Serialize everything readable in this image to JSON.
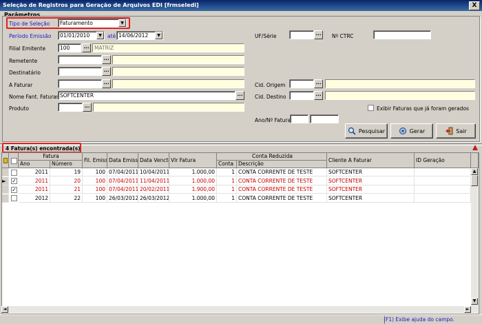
{
  "window": {
    "title": "Seleção de Registros para Geração de Arquivos EDI [frmseledi]",
    "close": "X"
  },
  "params": {
    "title": "Parâmetros",
    "tipo_label": "Tipo de Seleção",
    "tipo_value": "Faturamento",
    "periodo_label": "Período Emissão",
    "periodo_from": "01/01/2010",
    "ate_label": "até",
    "periodo_to": "14/06/2012",
    "filial_label": "Filial Emitente",
    "filial_code": "100",
    "filial_name": "MATRIZ",
    "remetente_label": "Remetente",
    "destinatario_label": "Destinatário",
    "afaturar_label": "A Faturar",
    "nomefant_label": "Nome Fant. Faturar",
    "nomefant_value": "SOFTCENTER",
    "produto_label": "Produto",
    "uf_label": "UF/Série",
    "nctrc_label": "Nº CTRC",
    "cidorigem_label": "Cid. Origem",
    "ciddestino_label": "Cid. Destino",
    "exibir_label": "Exibir Faturas que já foram gerados",
    "anofatura_label": "Ano/Nº Fatura",
    "dots": "..."
  },
  "buttons": {
    "pesquisar": "Pesquisar",
    "gerar": "Gerar",
    "sair": "Sair"
  },
  "grid": {
    "found": "4 Fatura(s) encontrada(s)",
    "group_fatura": "Fatura",
    "group_conta": "Conta Reduzida",
    "headers": {
      "ano": "Ano",
      "numero": "Número",
      "filemis": "Fil. Emiss.",
      "dataemis": "Data Emiss.",
      "datavencto": "Data Vencto",
      "vlrfatura": "Vlr Fatura",
      "conta": "Conta",
      "descricao": "Descrição",
      "cliente": "Cliente A Faturar",
      "idgeracao": "ID Geração"
    },
    "rows": [
      {
        "checked": "",
        "ano": "2011",
        "numero": "19",
        "fil": "100",
        "emis": "07/04/2011",
        "vencto": "10/04/2011",
        "vlr": "1.000,00",
        "conta": "1",
        "desc": "CONTA CORRENTE DE TESTE",
        "cliente": "SOFTCENTER",
        "id": "",
        "color": "#000000"
      },
      {
        "checked": "✓",
        "ano": "2011",
        "numero": "20",
        "fil": "100",
        "emis": "07/04/2011",
        "vencto": "11/04/2011",
        "vlr": "1.000,00",
        "conta": "1",
        "desc": "CONTA CORRENTE DE TESTE",
        "cliente": "SOFTCENTER",
        "id": "",
        "color": "#c00000"
      },
      {
        "checked": "✓",
        "ano": "2011",
        "numero": "21",
        "fil": "100",
        "emis": "07/04/2011",
        "vencto": "20/02/2011",
        "vlr": "1.900,00",
        "conta": "1",
        "desc": "CONTA CORRENTE DE TESTE",
        "cliente": "SOFTCENTER",
        "id": "",
        "color": "#c00000"
      },
      {
        "checked": "",
        "ano": "2012",
        "numero": "22",
        "fil": "100",
        "emis": "26/03/2012",
        "vencto": "26/03/2012",
        "vlr": "1.000,00",
        "conta": "1",
        "desc": "CONTA CORRENTE DE TESTE",
        "cliente": "SOFTCENTER",
        "id": "",
        "color": "#000000"
      }
    ]
  },
  "status": {
    "help": "(F1) Exibe ajuda do campo."
  }
}
